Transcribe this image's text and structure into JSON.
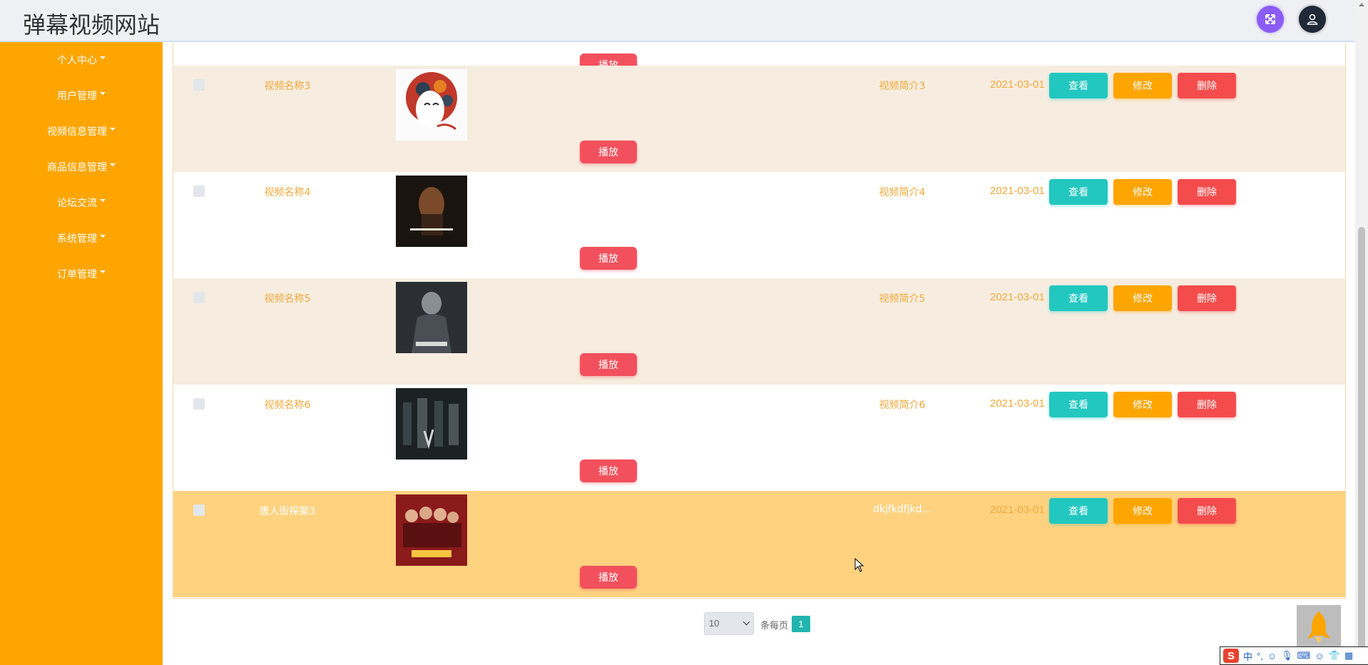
{
  "header": {
    "site_title": "弹幕视频网站",
    "icons": [
      "expand-icon",
      "user-icon"
    ]
  },
  "sidebar": {
    "items": [
      {
        "label": "个人中心"
      },
      {
        "label": "用户管理"
      },
      {
        "label": "视频信息管理"
      },
      {
        "label": "商品信息管理"
      },
      {
        "label": "论坛交流"
      },
      {
        "label": "系统管理"
      },
      {
        "label": "订单管理"
      }
    ]
  },
  "table": {
    "actions": {
      "view": "查看",
      "edit": "修改",
      "delete": "删除",
      "play": "播放"
    },
    "rows": [
      {
        "name": "视频名称3",
        "desc": "视频简介3",
        "date": "2021-03-01"
      },
      {
        "name": "视频名称4",
        "desc": "视频简介4",
        "date": "2021-03-01"
      },
      {
        "name": "视频名称5",
        "desc": "视频简介5",
        "date": "2021-03-01"
      },
      {
        "name": "视频名称6",
        "desc": "视频简介6",
        "date": "2021-03-01"
      },
      {
        "name": "唐人街探案3",
        "desc": "dkjfkdfjkd...",
        "date": "2021-03-01"
      }
    ]
  },
  "pagination": {
    "page_size": "10",
    "per_page_label": "条每页",
    "current_page": "1"
  },
  "ime": {
    "lang": "中",
    "punct": "°,"
  },
  "colors": {
    "sidebar": "#ffa500",
    "view_button": "#22c7c0",
    "edit_button": "#ffa500",
    "delete_button": "#f44c4c",
    "play_button": "#f2505c",
    "highlight_row": "#ffd280"
  }
}
